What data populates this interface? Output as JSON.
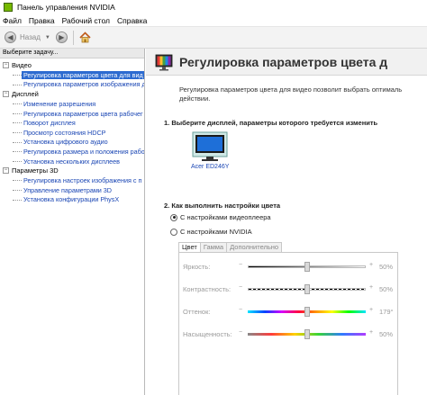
{
  "window": {
    "title": "Панель управления NVIDIA"
  },
  "menu": [
    "Файл",
    "Правка",
    "Рабочий стол",
    "Справка"
  ],
  "toolbar": {
    "back_label": "Назад"
  },
  "sidebar": {
    "header": "Выберите задачу...",
    "groups": [
      {
        "label": "Видео",
        "items": [
          {
            "label": "Регулировка параметров цвета для вид",
            "selected": true
          },
          {
            "label": "Регулировка параметров изображения д"
          }
        ]
      },
      {
        "label": "Дисплей",
        "items": [
          {
            "label": "Изменение разрешения"
          },
          {
            "label": "Регулировка параметров цвета рабочег"
          },
          {
            "label": "Поворот дисплея"
          },
          {
            "label": "Просмотр состояния HDCP"
          },
          {
            "label": "Установка цифрового аудио"
          },
          {
            "label": "Регулировка размера и положения рабо"
          },
          {
            "label": "Установка нескольких дисплеев"
          }
        ]
      },
      {
        "label": "Параметры 3D",
        "items": [
          {
            "label": "Регулировка настроек изображения с п"
          },
          {
            "label": "Управление параметрами 3D"
          },
          {
            "label": "Установка конфигурации PhysX"
          }
        ]
      }
    ]
  },
  "main": {
    "title": "Регулировка параметров цвета д",
    "description": "Регулировка параметров цвета для видео позволит выбрать оптималь действии.",
    "section1": "1. Выберите дисплей, параметры которого требуется изменить",
    "display_name": "Acer ED246Y",
    "section2": "2. Как выполнить настройки цвета",
    "radio1": "С настройками видеоплеера",
    "radio2": "С настройками NVIDIA",
    "tabs": [
      "Цвет",
      "Гамма",
      "Дополнительно"
    ],
    "sliders": [
      {
        "label": "Яркость:",
        "value": "50%",
        "level": 0.5
      },
      {
        "label": "Контрастность:",
        "value": "50%",
        "level": 0.5
      },
      {
        "label": "Оттенок:",
        "value": "179°",
        "level": 0.5
      },
      {
        "label": "Насыщенность:",
        "value": "50%",
        "level": 0.5
      }
    ]
  },
  "colors": {
    "accent": "#2d6bd0",
    "nvidia_green": "#76b900",
    "link": "#1a46b4"
  }
}
